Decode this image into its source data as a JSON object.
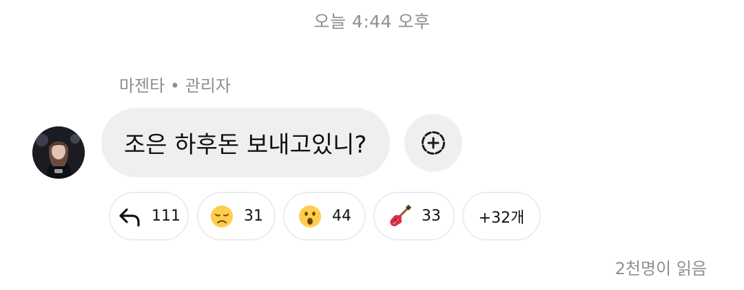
{
  "timestamp": "오늘 4:44 오후",
  "sender": {
    "name": "마젠타",
    "separator": "•",
    "role": "관리자"
  },
  "message": {
    "text": "조은 하후돈 보내고있니?"
  },
  "reactions": [
    {
      "icon": "reply-arrow-icon",
      "count": "111"
    },
    {
      "icon": "disappointed-face-emoji",
      "count": "31"
    },
    {
      "icon": "astonished-face-emoji",
      "count": "44"
    },
    {
      "icon": "guitar-emoji",
      "count": "33"
    },
    {
      "label": "+32개"
    }
  ],
  "read_status": "2천명이 읽음",
  "colors": {
    "bubble_background": "#efefef",
    "secondary_text": "#8e8e8e",
    "pill_border": "#ececec"
  }
}
